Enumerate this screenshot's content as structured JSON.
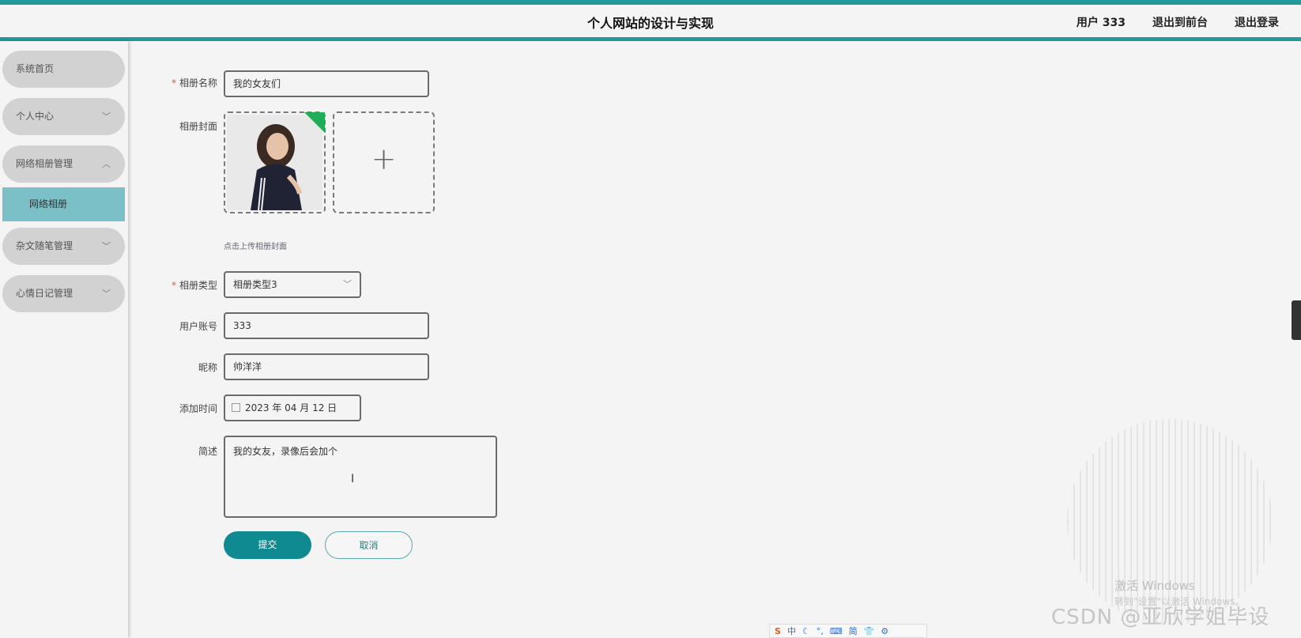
{
  "header": {
    "title": "个人网站的设计与实现",
    "user": "用户 333",
    "to_front": "退出到前台",
    "logout": "退出登录"
  },
  "sidebar": {
    "items": [
      {
        "label": "系统首页"
      },
      {
        "label": "个人中心"
      },
      {
        "label": "网络相册管理"
      },
      {
        "label": "网络相册"
      },
      {
        "label": "杂文随笔管理"
      },
      {
        "label": "心情日记管理"
      }
    ]
  },
  "form": {
    "album_name_label": "相册名称",
    "album_name_value": "我的女友们",
    "cover_label": "相册封面",
    "cover_hint": "点击上传相册封面",
    "type_label": "相册类型",
    "type_value": "相册类型3",
    "account_label": "用户账号",
    "account_value": "333",
    "nickname_label": "昵称",
    "nickname_value": "帅洋洋",
    "time_label": "添加时间",
    "time_value": "2023 年 04 月 12 日",
    "desc_label": "简述",
    "desc_value": "我的女友，录像后会加个",
    "required_mark": "*"
  },
  "buttons": {
    "submit": "提交",
    "cancel": "取消"
  },
  "watermarks": {
    "windows_activate": "激活 Windows",
    "windows_hint": "转到\"设置\"以激活 Windows。",
    "csdn": "CSDN @亚欣学姐毕设"
  },
  "ime": {
    "items": [
      "中",
      "简"
    ]
  },
  "colors": {
    "accent": "#22999c",
    "submit_bg": "#0f8a91",
    "submenu_active": "#7bc0c6"
  }
}
